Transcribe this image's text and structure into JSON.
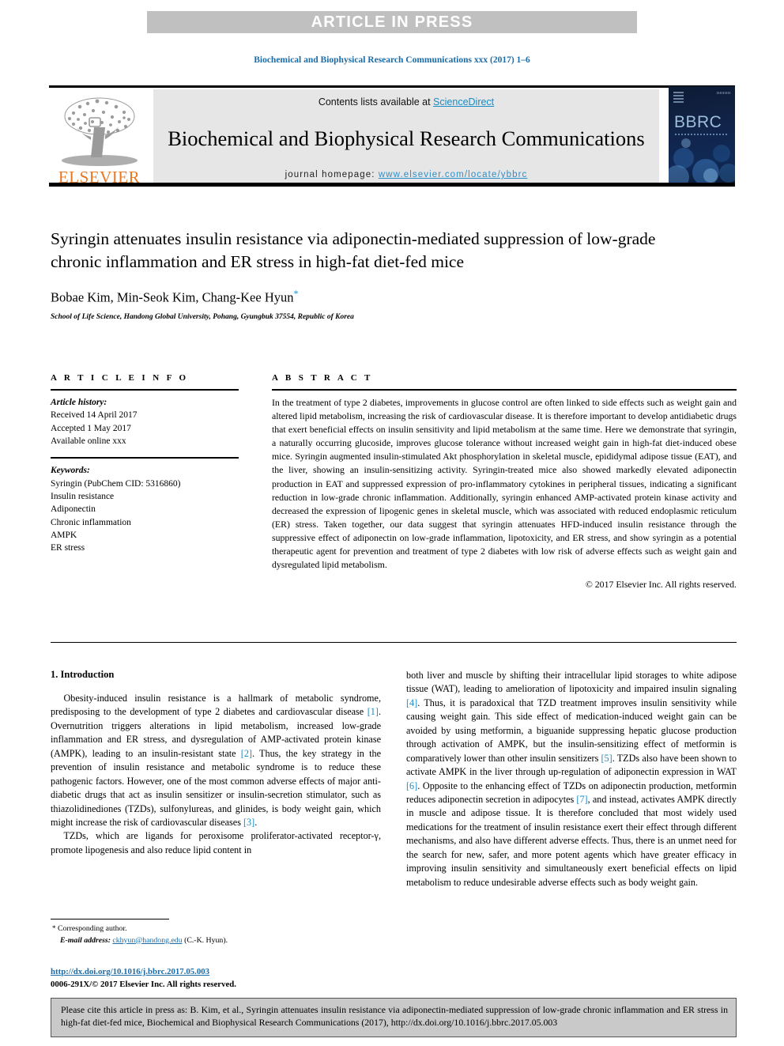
{
  "banner": {
    "label": "ARTICLE IN PRESS"
  },
  "running_head": "Biochemical and Biophysical Research Communications xxx (2017) 1–6",
  "masthead": {
    "contents_prefix": "Contents lists available at ",
    "sciencedirect": "ScienceDirect",
    "journal_name": "Biochemical and Biophysical Research Communications",
    "homepage_label": "journal homepage: ",
    "homepage_url": "www.elsevier.com/locate/ybbrc",
    "publisher_logo_text": "ELSEVIER",
    "cover_badge": "BBRC",
    "accent_link_color": "#1a8bc4",
    "publisher_orange": "#e87722"
  },
  "article": {
    "title": "Syringin attenuates insulin resistance via adiponectin-mediated suppression of low-grade chronic inflammation and ER stress in high-fat diet-fed mice",
    "authors": "Bobae Kim, Min-Seok Kim, Chang-Kee Hyun",
    "corresponding_marker": "*",
    "affiliation": "School of Life Science, Handong Global University, Pohang, Gyungbuk 37554, Republic of Korea"
  },
  "article_info": {
    "heading": "A R T I C L E  I N F O",
    "history_label": "Article history:",
    "history": [
      "Received 14 April 2017",
      "Accepted 1 May 2017",
      "Available online xxx"
    ],
    "keywords_label": "Keywords:",
    "keywords": [
      "Syringin (PubChem CID: 5316860)",
      "Insulin resistance",
      "Adiponectin",
      "Chronic inflammation",
      "AMPK",
      "ER stress"
    ]
  },
  "abstract": {
    "heading": "A B S T R A C T",
    "text": "In the treatment of type 2 diabetes, improvements in glucose control are often linked to side effects such as weight gain and altered lipid metabolism, increasing the risk of cardiovascular disease. It is therefore important to develop antidiabetic drugs that exert beneficial effects on insulin sensitivity and lipid metabolism at the same time. Here we demonstrate that syringin, a naturally occurring glucoside, improves glucose tolerance without increased weight gain in high-fat diet-induced obese mice. Syringin augmented insulin-stimulated Akt phosphorylation in skeletal muscle, epididymal adipose tissue (EAT), and the liver, showing an insulin-sensitizing activity. Syringin-treated mice also showed markedly elevated adiponectin production in EAT and suppressed expression of pro-inflammatory cytokines in peripheral tissues, indicating a significant reduction in low-grade chronic inflammation. Additionally, syringin enhanced AMP-activated protein kinase activity and decreased the expression of lipogenic genes in skeletal muscle, which was associated with reduced endoplasmic reticulum (ER) stress. Taken together, our data suggest that syringin attenuates HFD-induced insulin resistance through the suppressive effect of adiponectin on low-grade inflammation, lipotoxicity, and ER stress, and show syringin as a potential therapeutic agent for prevention and treatment of type 2 diabetes with low risk of adverse effects such as weight gain and dysregulated lipid metabolism.",
    "copyright": "© 2017 Elsevier Inc. All rights reserved."
  },
  "introduction": {
    "heading": "1. Introduction",
    "left_paragraph_1_a": "Obesity-induced insulin resistance is a hallmark of metabolic syndrome, predisposing to the development of type 2 diabetes and cardiovascular disease ",
    "ref_1": "[1]",
    "left_paragraph_1_b": ". Overnutrition triggers alterations in lipid metabolism, increased low-grade inflammation and ER stress, and dysregulation of AMP-activated protein kinase (AMPK), leading to an insulin-resistant state ",
    "ref_2": "[2]",
    "left_paragraph_1_c": ". Thus, the key strategy in the prevention of insulin resistance and metabolic syndrome is to reduce these pathogenic factors. However, one of the most common adverse effects of major anti-diabetic drugs that act as insulin sensitizer or insulin-secretion stimulator, such as thiazolidinediones (TZDs), sulfonylureas, and glinides, is body weight gain, which might increase the risk of cardiovascular diseases ",
    "ref_3": "[3]",
    "left_paragraph_1_d": ".",
    "left_paragraph_2": "TZDs, which are ligands for peroxisome proliferator-activated receptor-γ, promote lipogenesis and also reduce lipid content in",
    "right_paragraph_a": "both liver and muscle by shifting their intracellular lipid storages to white adipose tissue (WAT), leading to amelioration of lipotoxicity and impaired insulin signaling ",
    "ref_4": "[4]",
    "right_paragraph_b": ". Thus, it is paradoxical that TZD treatment improves insulin sensitivity while causing weight gain. This side effect of medication-induced weight gain can be avoided by using metformin, a biguanide suppressing hepatic glucose production through activation of AMPK, but the insulin-sensitizing effect of metformin is comparatively lower than other insulin sensitizers ",
    "ref_5": "[5]",
    "right_paragraph_c": ". TZDs also have been shown to activate AMPK in the liver through up-regulation of adiponectin expression in WAT ",
    "ref_6": "[6]",
    "right_paragraph_d": ". Opposite to the enhancing effect of TZDs on adiponectin production, metformin reduces adiponectin secretion in adipocytes ",
    "ref_7": "[7]",
    "right_paragraph_e": ", and instead, activates AMPK directly in muscle and adipose tissue. It is therefore concluded that most widely used medications for the treatment of insulin resistance exert their effect through different mechanisms, and also have different adverse effects. Thus, there is an unmet need for the search for new, safer, and more potent agents which have greater efficacy in improving insulin sensitivity and simultaneously exert beneficial effects on lipid metabolism to reduce undesirable adverse effects such as body weight gain."
  },
  "footnote": {
    "star": "*",
    "corresponding_label": "Corresponding author.",
    "email_label": "E-mail address:",
    "email": "ckhyun@handong.edu",
    "email_suffix": "(C.-K. Hyun).",
    "doi_url": "http://dx.doi.org/10.1016/j.bbrc.2017.05.003",
    "issn_line": "0006-291X/© 2017 Elsevier Inc. All rights reserved."
  },
  "citation_box": {
    "text": "Please cite this article in press as: B. Kim, et al., Syringin attenuates insulin resistance via adiponectin-mediated suppression of low-grade chronic inflammation and ER stress in high-fat diet-fed mice, Biochemical and Biophysical Research Communications (2017), http://dx.doi.org/10.1016/j.bbrc.2017.05.003"
  }
}
